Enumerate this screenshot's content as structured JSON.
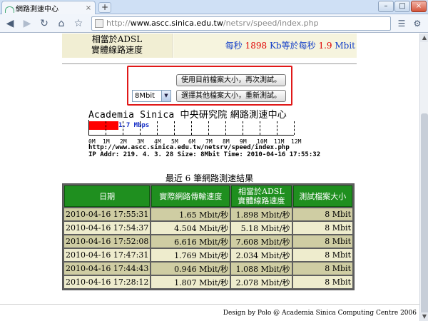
{
  "browser": {
    "tab_title": "網路測速中心",
    "tab_close": "×",
    "new_tab": "+",
    "url_scheme": "http://",
    "url_host": "www.ascc.sinica.edu.tw",
    "url_path": "/netsrv/speed/index.php",
    "window_controls": [
      "–",
      "□",
      "×"
    ]
  },
  "top_info": {
    "left_line1": "相當於ADSL",
    "left_line2": "實體線路速度",
    "per_sec_1": "每秒",
    "kb_value": "1898",
    "kb_unit": "Kb等於",
    "per_sec_2": "每秒",
    "mbit_value": "1.9",
    "mbit_unit": "Mbit"
  },
  "controls": {
    "retest_same_label": "使用目前檔案大小，再次測試。",
    "retest_other_label": "選擇其他檔案大小，重新測試。",
    "file_size_selected": "8Mbit"
  },
  "meter": {
    "title_en": "Academia Sinica",
    "title_cn": "中央研究院 網路測速中心",
    "speed_label": "1.7 Mbps",
    "speed_mbps": 1.7,
    "max_mbps": 12,
    "tick_labels": [
      "0M",
      "1M",
      "2M",
      "3M",
      "4M",
      "5M",
      "6M",
      "7M",
      "8M",
      "9M",
      "10M",
      "11M",
      "12M"
    ],
    "url_text": "http://www.ascc.sinica.edu.tw/netsrv/speed/index.php",
    "info_text": "IP Addr: 219. 4. 3. 28 Size: 8Mbit Time: 2010-04-16 17:55:32"
  },
  "results": {
    "caption": "最近 6 筆網路測速結果",
    "headers": [
      "日期",
      "實際網路傳輸速度",
      "相當於ADSL\n實體線路速度",
      "測試檔案大小"
    ],
    "rows": [
      [
        "2010-04-16 17:55:31",
        "1.65 Mbit/秒",
        "1.898 Mbit/秒",
        "8 Mbit"
      ],
      [
        "2010-04-16 17:54:37",
        "4.504 Mbit/秒",
        "5.18 Mbit/秒",
        "8 Mbit"
      ],
      [
        "2010-04-16 17:52:08",
        "6.616 Mbit/秒",
        "7.608 Mbit/秒",
        "8 Mbit"
      ],
      [
        "2010-04-16 17:47:31",
        "1.769 Mbit/秒",
        "2.034 Mbit/秒",
        "8 Mbit"
      ],
      [
        "2010-04-16 17:44:43",
        "0.946 Mbit/秒",
        "1.088 Mbit/秒",
        "8 Mbit"
      ],
      [
        "2010-04-16 17:28:12",
        "1.807 Mbit/秒",
        "2.078 Mbit/秒",
        "8 Mbit"
      ]
    ]
  },
  "footer": "Design by Polo @ Academia Sinica Computing Centre 2006",
  "icons": {
    "back": "back-arrow-icon",
    "forward": "forward-arrow-icon",
    "reload": "reload-icon",
    "home": "home-icon",
    "bookmark": "star-icon",
    "page_menu": "page-icon",
    "tools_menu": "wrench-icon"
  }
}
